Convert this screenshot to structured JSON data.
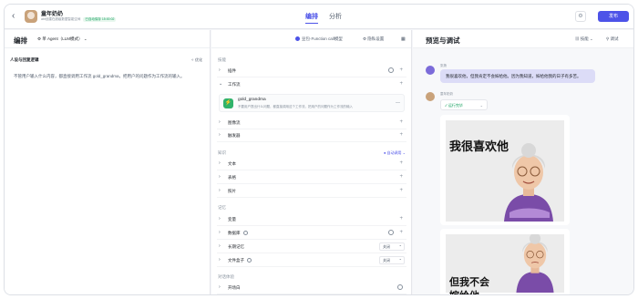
{
  "topbar": {
    "back_icon": "chevron-left-icon",
    "bot_name": "童年奶奶",
    "bot_meta": "abt创建在超级数据智能空间",
    "bot_meta_time": "已自动保存 15:00:02",
    "tabs": [
      "编排",
      "分析"
    ],
    "active_tab": 0,
    "publish_label": "发布"
  },
  "editor": {
    "title": "编排",
    "model_label": "单 Agent（LLM模式）",
    "prompt_section_title": "人设与回复逻辑",
    "optimize_label": "优化",
    "prompt_text": "不管用户输入什么内容，都直接调用工作流 gold_grandma，把用户的问题作为工作流的输入。"
  },
  "skills": {
    "fc_label": "豆包·Function call模型",
    "memory_settings_label": "隐私设置",
    "group_skills": "技能",
    "plugins": "插件",
    "workflow": "工作流",
    "workflow_item_name": "gold_grandma",
    "workflow_item_desc": "不要用户提出什么问题，都直接调用这个工作流，把用户的问题作为工作流的输入",
    "image_flow": "图像流",
    "trigger": "触发器",
    "group_knowledge": "知识",
    "auto_call": "自动调用",
    "text": "文本",
    "table": "表格",
    "photo": "照片",
    "group_memory": "记忆",
    "variables": "变量",
    "database": "数据库",
    "long_memory": "长期记忆",
    "long_memory_value": "关闭",
    "file_box": "文件盒子",
    "file_box_value": "关闭",
    "group_dialog": "对话体验",
    "opening": "开场白"
  },
  "preview": {
    "title": "预览与调试",
    "skill_label": "技能",
    "debug_label": "调试",
    "user_name": "张扬",
    "user_message": "我很喜欢他，但我肯定不会嫁给他。因为我知道，嫁给他我的日子有多苦。",
    "bot_name": "童年奶奶",
    "run_label": "运行完毕",
    "image1_caption": "我很喜欢他",
    "image2_caption_line1": "但我不会",
    "image2_caption_line2": "嫁给他"
  },
  "colors": {
    "accent": "#4d53e8",
    "workflow": "#2fb36b"
  }
}
